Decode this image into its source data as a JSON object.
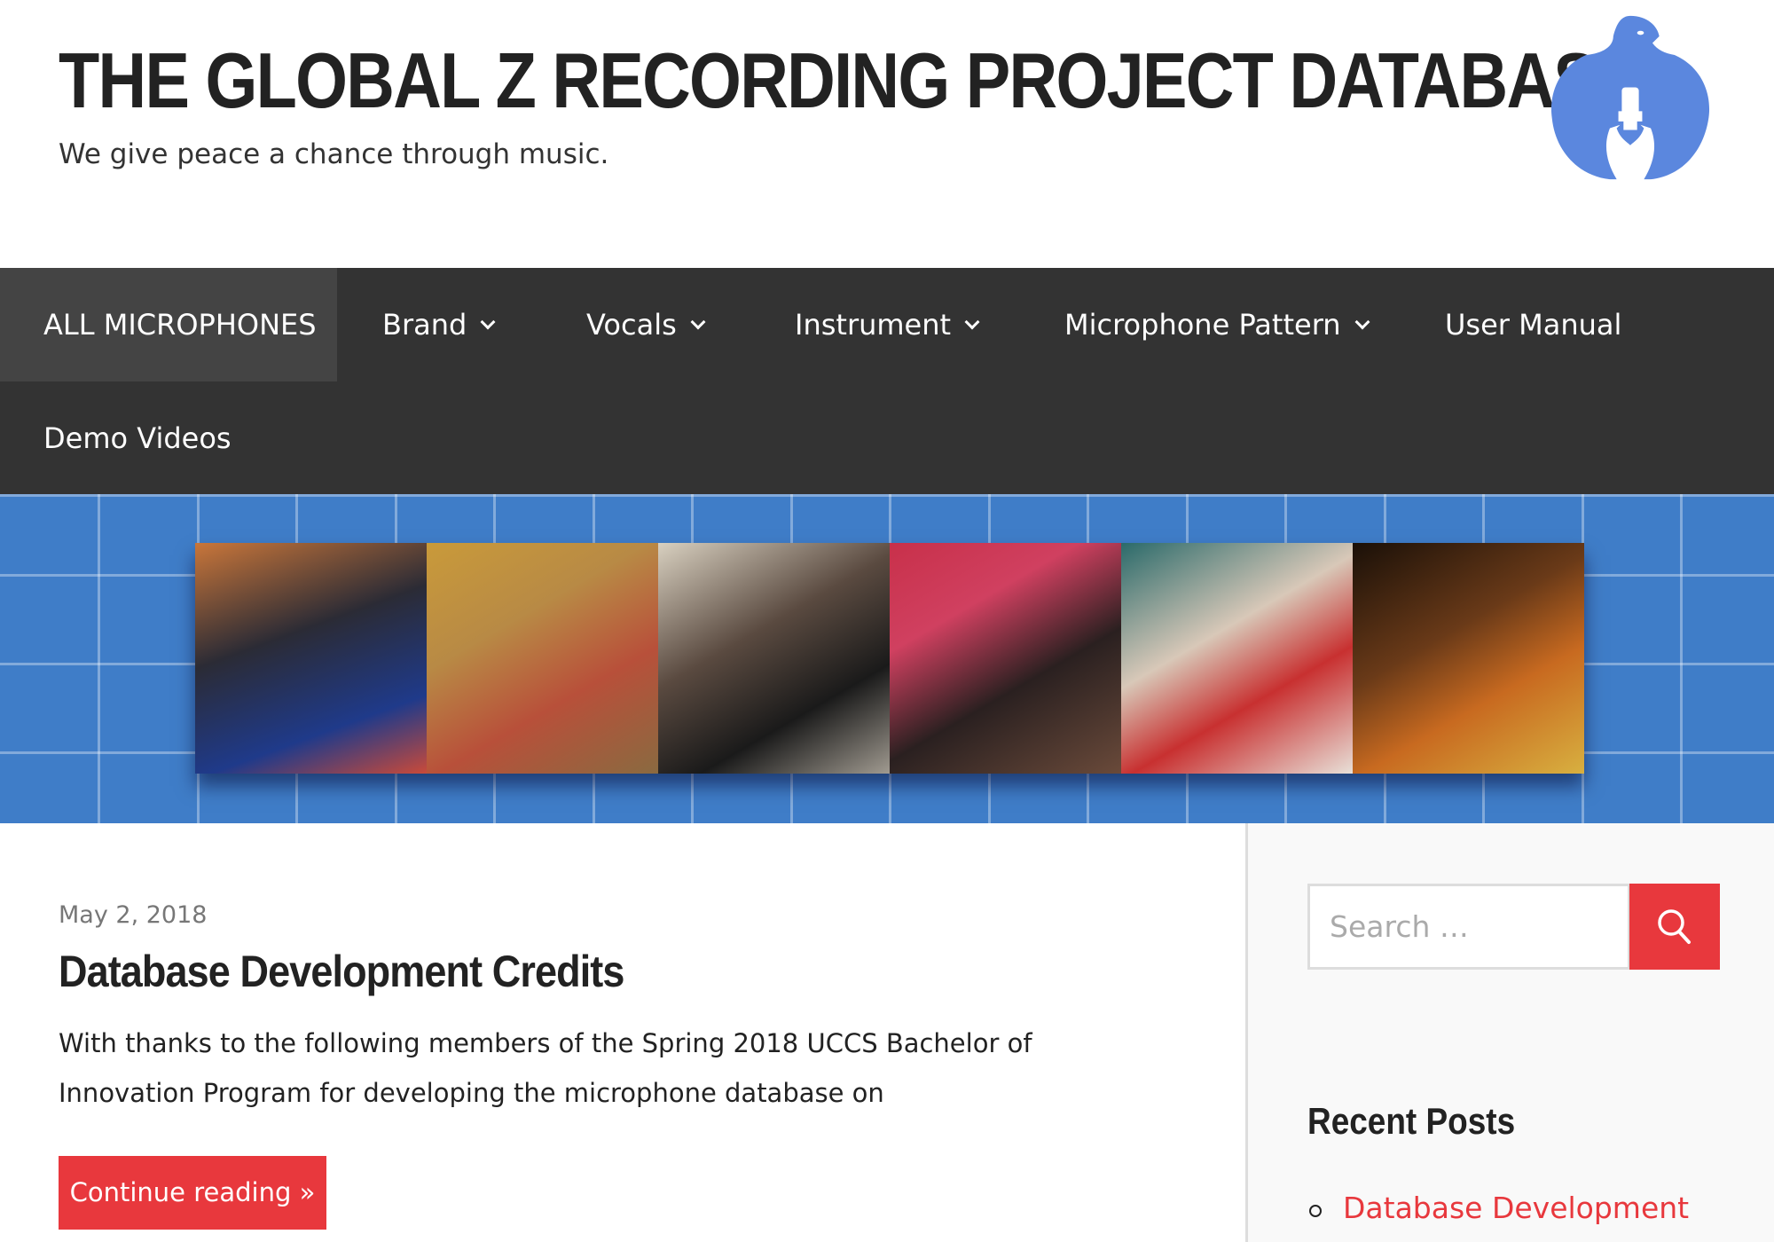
{
  "header": {
    "title": "THE GLOBAL Z RECORDING PROJECT DATABASE",
    "tagline": "We give peace a chance through music.",
    "logo_icon": "dove-microphone-logo",
    "logo_color": "#5b87de"
  },
  "nav": {
    "items": [
      {
        "label": "ALL MICROPHONES",
        "active": true
      },
      {
        "label": "Brand",
        "dropdown": true
      },
      {
        "label": "Vocals",
        "dropdown": true
      },
      {
        "label": "Instrument",
        "dropdown": true
      },
      {
        "label": "Microphone Pattern",
        "dropdown": true
      },
      {
        "label": "User Manual"
      },
      {
        "label": "Demo Videos"
      }
    ]
  },
  "post": {
    "date": "May 2, 2018",
    "title": "Database Development Credits",
    "excerpt": "With thanks to the following members of the Spring 2018  UCCS Bachelor of Innovation Program for developing the microphone database on",
    "continue_label": "Continue reading »"
  },
  "sidebar": {
    "search_placeholder": "Search …",
    "search_icon": "search-icon",
    "recent_title": "Recent Posts",
    "recent_posts": [
      "Database Development"
    ]
  },
  "colors": {
    "accent": "#e8383d",
    "nav_bg": "#333333",
    "banner_blue": "#3f7dc8"
  }
}
